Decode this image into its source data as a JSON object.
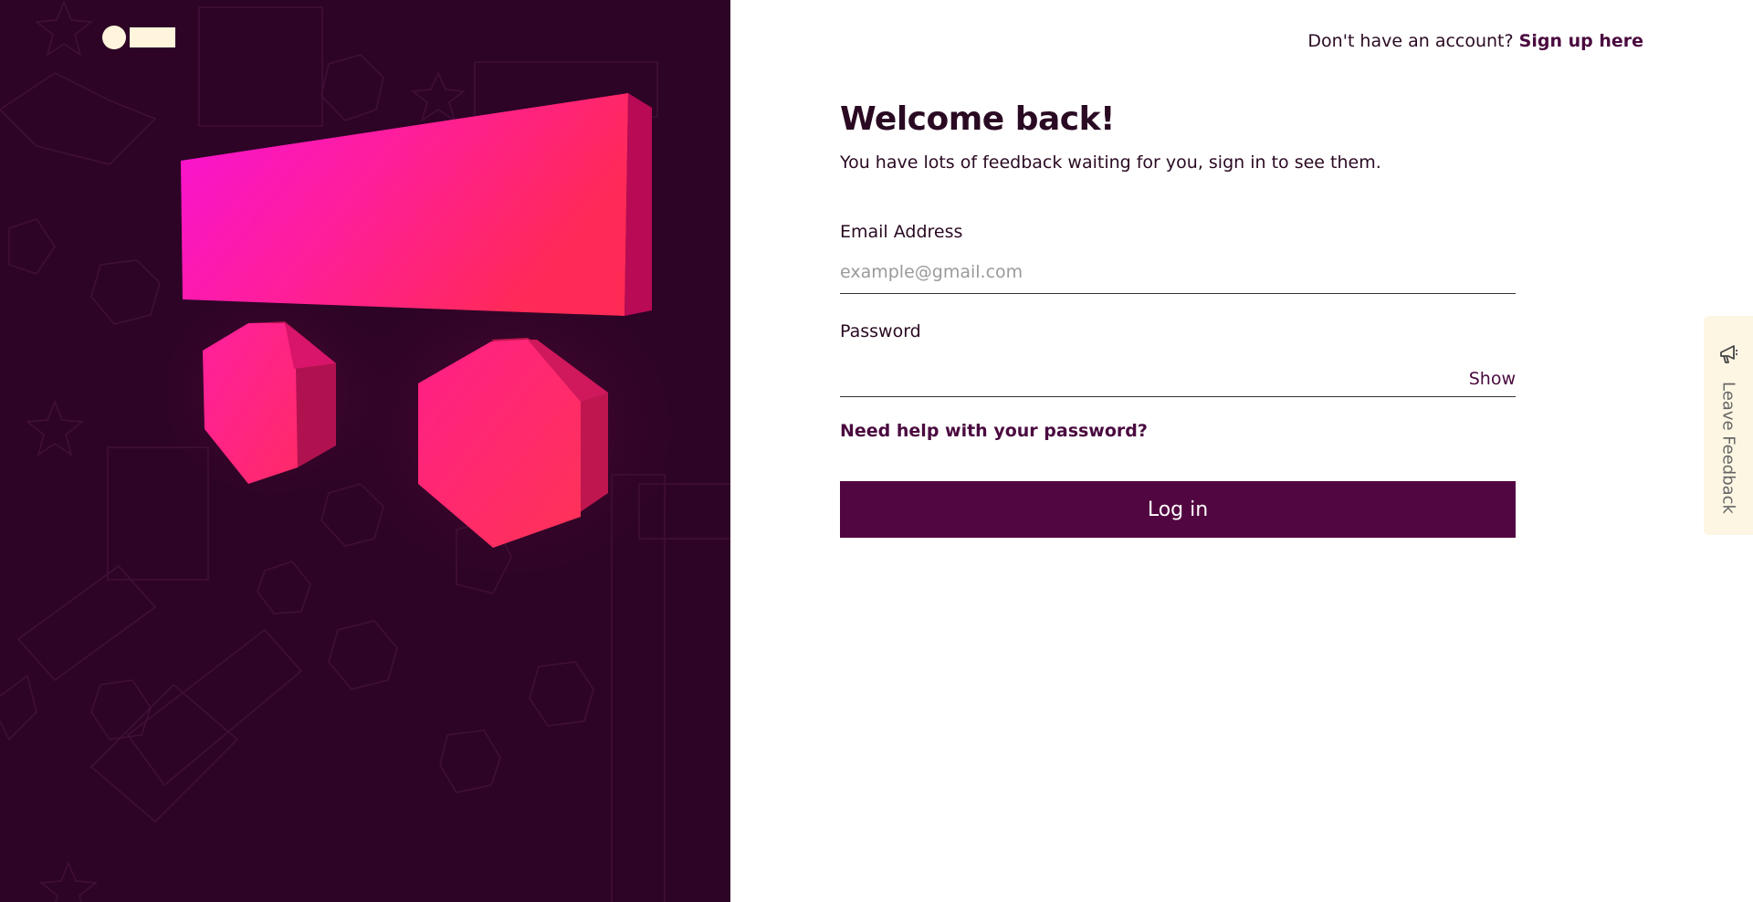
{
  "header": {
    "prompt": "Don't have an account?",
    "signup_link": "Sign up here"
  },
  "form": {
    "title": "Welcome back!",
    "subtitle": "You have lots of feedback waiting for you, sign in to see them.",
    "email_label": "Email Address",
    "email_placeholder": "example@gmail.com",
    "email_value": "",
    "password_label": "Password",
    "password_value": "",
    "show_label": "Show",
    "help_link": "Need help with your password?",
    "login_button": "Log in"
  },
  "feedback_tab": {
    "label": "Leave Feedback",
    "icon": "megaphone-icon"
  },
  "colors": {
    "left_bg": "#2d0426",
    "brand": "#520641",
    "accent_pink": "#ff1e8c",
    "logo": "#fff5dc"
  }
}
